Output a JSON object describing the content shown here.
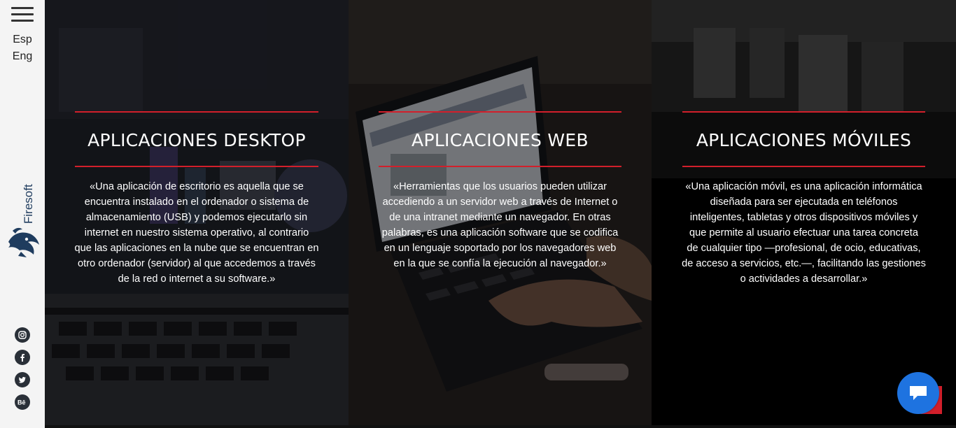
{
  "sidebar": {
    "lang_es": "Esp",
    "lang_en": "Eng",
    "brand": "Firesoft",
    "social": [
      {
        "name": "instagram-icon",
        "glyph": "◎"
      },
      {
        "name": "facebook-icon",
        "glyph": "f"
      },
      {
        "name": "twitter-icon",
        "glyph": "t"
      },
      {
        "name": "behance-icon",
        "glyph": "Bē"
      }
    ]
  },
  "panels": [
    {
      "title": "APLICACIONES DESKTOP",
      "lines": [
        "«Una aplicación de escritorio es aquella que se",
        "encuentra instalado en el ordenador o sistema de",
        "almacenamiento (USB) y podemos ejecutarlo sin",
        "internet en nuestro sistema operativo, al contrario",
        "que las aplicaciones en la nube que se encuentran en",
        "otro ordenador (servidor) al que accedemos a través",
        "de la red o internet a su software.»"
      ]
    },
    {
      "title": "APLICACIONES WEB",
      "lines": [
        "«Herramientas que los usuarios pueden utilizar",
        "accediendo a un servidor web a través de Internet o",
        "de una intranet mediante un navegador. En otras",
        "palabras, es una aplicación software que se codifica",
        "en un lenguaje soportado por los navegadores web",
        "en la que se confía la ejecución al navegador.»"
      ]
    },
    {
      "title": "APLICACIONES MÓVILES",
      "lines": [
        "«Una aplicación móvil, es una aplicación informática",
        "diseñada para ser ejecutada en teléfonos",
        "inteligentes, tabletas y otros dispositivos móviles y",
        "que permite al usuario efectuar una tarea concreta",
        "de cualquier tipo —profesional, de ocio, educativas,",
        "de acceso a servicios, etc.—, facilitando las gestiones",
        "o actividades a desarrollar.»"
      ]
    }
  ],
  "colors": {
    "accent": "#d21f2b",
    "chat": "#1e73e0"
  }
}
